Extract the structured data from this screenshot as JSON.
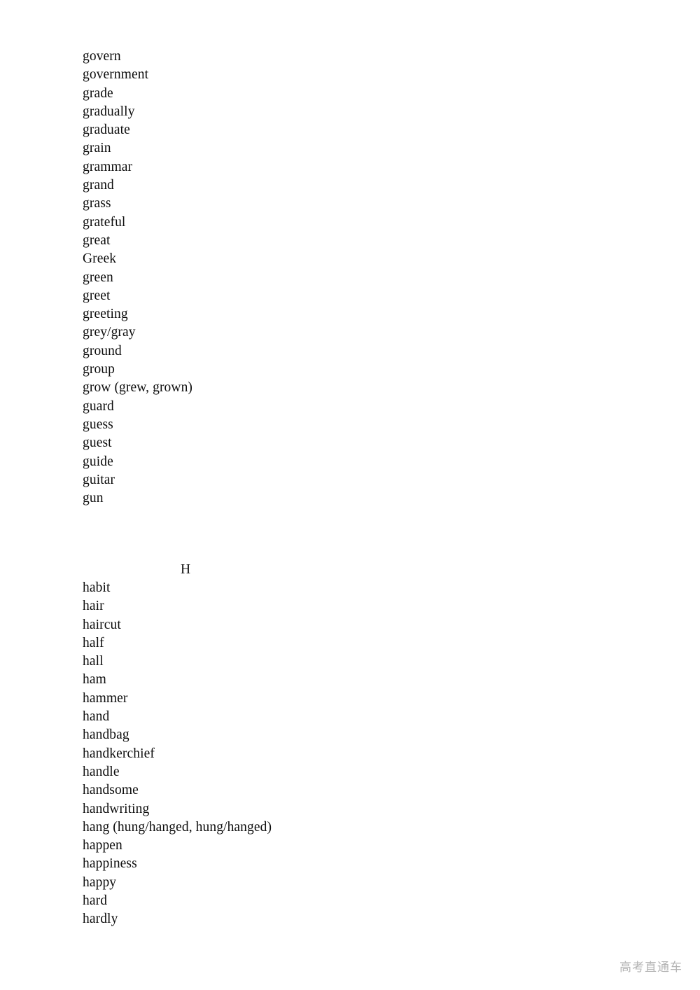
{
  "document": {
    "type": "vocabulary-word-list",
    "sections": [
      {
        "letter": "",
        "heading_visible": false,
        "words": [
          "govern",
          "government",
          "grade",
          "gradually",
          "graduate",
          "grain",
          "grammar",
          "grand",
          "grass",
          "grateful",
          "great",
          "Greek",
          "green",
          "greet",
          "greeting",
          "grey/gray",
          "ground",
          "group",
          "grow (grew, grown)",
          "guard",
          "guess",
          "guest",
          "guide",
          "guitar",
          "gun"
        ]
      },
      {
        "letter": "H",
        "heading_visible": true,
        "words": [
          "habit",
          "hair",
          "haircut",
          "half",
          "hall",
          "ham",
          "hammer",
          "hand",
          "handbag",
          "handkerchief",
          "handle",
          "handsome",
          "handwriting",
          "hang (hung/hanged, hung/hanged)",
          "happen",
          "happiness",
          "happy",
          "hard",
          "hardly"
        ]
      }
    ]
  },
  "watermark": {
    "text": "高考直通车",
    "color": "#b4b4b4"
  },
  "colors": {
    "page_background": "#ffffff",
    "body_text": "#0d0d0d"
  }
}
